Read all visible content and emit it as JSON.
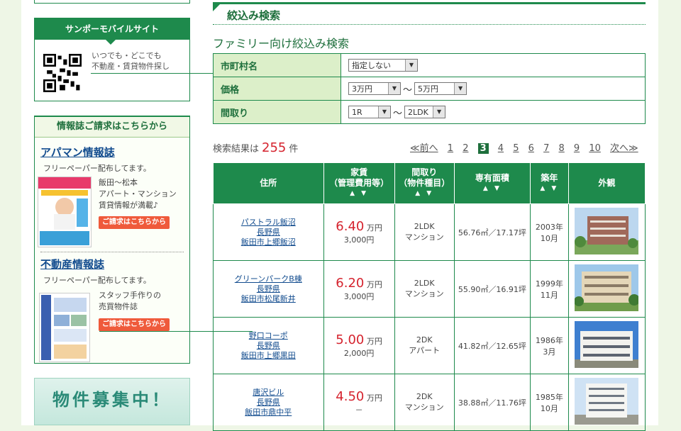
{
  "sidebar": {
    "mobile": {
      "title": "サンポーモバイルサイト",
      "text_line1": "いつでも・どこでも",
      "text_line2": "不動産・賃貸物件探し"
    },
    "magazines": {
      "header": "情報誌ご請求はこちらから",
      "items": [
        {
          "title": "アパマン情報誌",
          "subtitle": "フリーペーパー配布してます。",
          "desc1": "飯田～松本",
          "desc2": "アパート・マンション",
          "desc3": "賃貸情報が満載♪",
          "button": "ご請求はこちらから"
        },
        {
          "title": "不動産情報誌",
          "subtitle": "フリーペーパー配布してます。",
          "desc1": "スタッフ手作りの",
          "desc2": "売買物件誌",
          "desc3": "",
          "button": "ご請求はこちらから"
        }
      ]
    },
    "recruit_banner": "物件募集中！"
  },
  "search": {
    "section_title": "絞込み検索",
    "family_title": "ファミリー向け絞込み検索",
    "rows": [
      {
        "label": "市町村名",
        "value1": "指定しない"
      },
      {
        "label": "価格",
        "value1": "3万円",
        "separator": "～",
        "value2": "5万円"
      },
      {
        "label": "間取り",
        "value1": "1R",
        "separator": "～",
        "value2": "2LDK"
      }
    ]
  },
  "results": {
    "prefix": "検索結果は",
    "count": "255",
    "suffix": "件",
    "pager": {
      "prev": "≪前へ",
      "pages": [
        "1",
        "2",
        "3",
        "4",
        "5",
        "6",
        "7",
        "8",
        "9",
        "10"
      ],
      "current": "3",
      "next": "次へ≫"
    },
    "headers": {
      "address": "住所",
      "rent_line1": "家賃",
      "rent_line2": "（管理費用等）",
      "layout_line1": "間取り",
      "layout_line2": "（物件種目）",
      "area": "専有面積",
      "year": "築年",
      "photo": "外観",
      "sort": "▲ ▼"
    },
    "rows": [
      {
        "name": "パストラル飯沼",
        "pref": "長野県",
        "city": "飯田市上郷飯沼",
        "rent": "6.40",
        "unit": "万円",
        "mgmt": "3,000円",
        "layout": "2LDK",
        "kind": "マンション",
        "area": "56.76㎡／17.17坪",
        "year": "2003年",
        "month": "10月"
      },
      {
        "name": "グリーンパークB棟",
        "pref": "長野県",
        "city": "飯田市松尾新井",
        "rent": "6.20",
        "unit": "万円",
        "mgmt": "3,000円",
        "layout": "2LDK",
        "kind": "マンション",
        "area": "55.90㎡／16.91坪",
        "year": "1999年",
        "month": "11月"
      },
      {
        "name": "野口コーポ",
        "pref": "長野県",
        "city": "飯田市上郷黒田",
        "rent": "5.00",
        "unit": "万円",
        "mgmt": "2,000円",
        "layout": "2DK",
        "kind": "アパート",
        "area": "41.82㎡／12.65坪",
        "year": "1986年",
        "month": "3月"
      },
      {
        "name": "唐沢ビル",
        "pref": "長野県",
        "city": "飯田市鼎中平",
        "rent": "4.50",
        "unit": "万円",
        "mgmt": "－",
        "layout": "2DK",
        "kind": "マンション",
        "area": "38.88㎡／11.76坪",
        "year": "1985年",
        "month": "10月"
      }
    ]
  }
}
